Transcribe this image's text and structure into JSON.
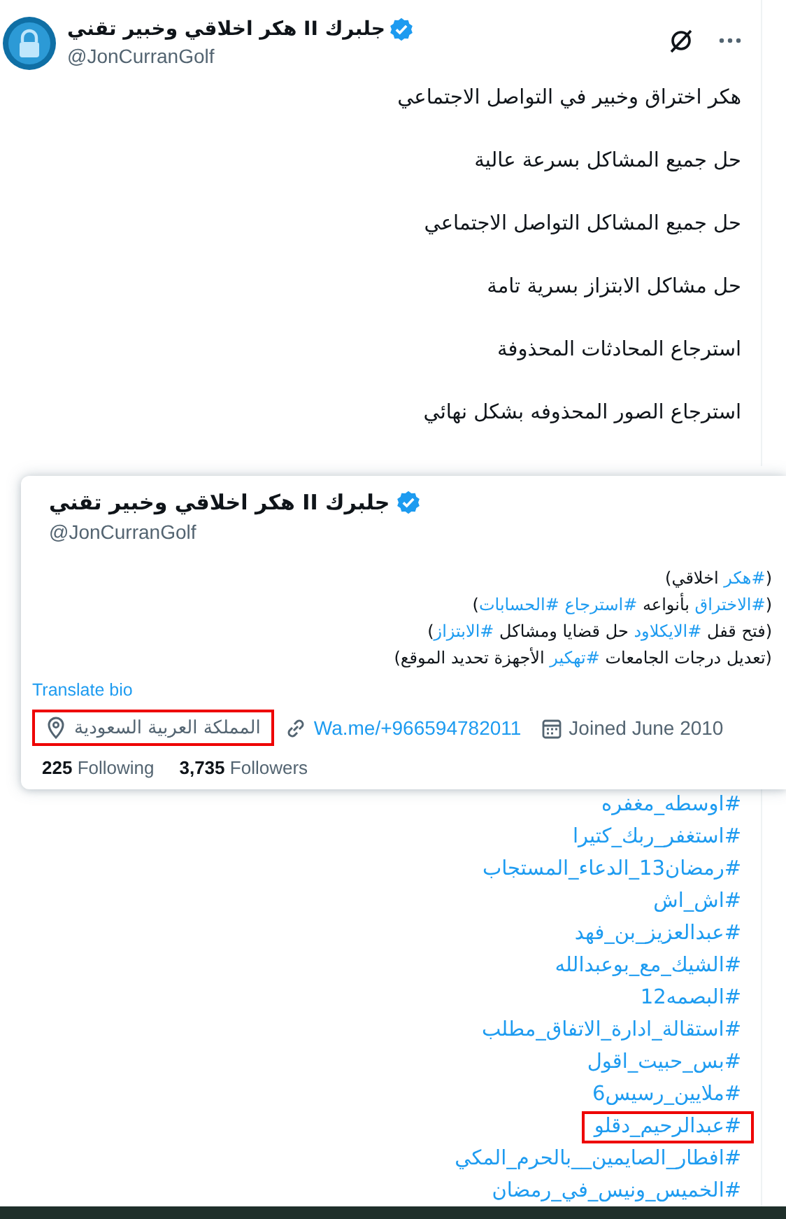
{
  "tweet": {
    "name": "جلبرك II هكر اخلاقي وخبير تقني",
    "verified": true,
    "handle": "@JonCurranGolf",
    "lines": [
      "هكر اختراق وخبير في التواصل الاجتماعي",
      "حل جميع المشاكل بسرعة عالية",
      "حل جميع المشاكل التواصل الاجتماعي",
      "حل مشاكل الابتزاز بسرية تامة",
      "استرجاع المحادثات المحذوفة",
      "استرجاع الصور المحذوفه بشكل نهائي"
    ]
  },
  "hover_card": {
    "name": "جلبرك II هكر اخلاقي وخبير تقني",
    "verified": true,
    "handle": "@JonCurranGolf",
    "bio": [
      [
        {
          "kind": "plain",
          "text": "("
        },
        {
          "kind": "hashtag",
          "text": "#هكر"
        },
        {
          "kind": "plain",
          "text": " اخلاقي)"
        }
      ],
      [
        {
          "kind": "plain",
          "text": "("
        },
        {
          "kind": "hashtag",
          "text": "#الاختراق"
        },
        {
          "kind": "plain",
          "text": " بأنواعه "
        },
        {
          "kind": "hashtag",
          "text": "#استرجاع "
        },
        {
          "kind": "hashtag",
          "text": "#الحسابات"
        },
        {
          "kind": "plain",
          "text": ")"
        }
      ],
      [
        {
          "kind": "plain",
          "text": "(فتح قفل "
        },
        {
          "kind": "hashtag",
          "text": "#الايكلاود"
        },
        {
          "kind": "plain",
          "text": " حل قضايا ومشاكل "
        },
        {
          "kind": "hashtag",
          "text": "#الابتزاز"
        },
        {
          "kind": "plain",
          "text": ")"
        }
      ],
      [
        {
          "kind": "plain",
          "text": "(تعديل درجات الجامعات "
        },
        {
          "kind": "hashtag",
          "text": "#تهكير"
        },
        {
          "kind": "plain",
          "text": " الأجهزة تحديد الموقع)"
        }
      ]
    ],
    "translate": "Translate bio",
    "location": {
      "text": "المملكة العربية السعودية",
      "highlighted": true
    },
    "link": "Wa.me/+966594782011",
    "joined": "Joined June 2010",
    "following": {
      "count": "225",
      "label": "Following"
    },
    "followers": {
      "count": "3,735",
      "label": "Followers"
    }
  },
  "hashtags": [
    {
      "text": "#اوسطه_مغفره",
      "highlighted": false
    },
    {
      "text": "#استغفر_ربك_كتيرا",
      "highlighted": false
    },
    {
      "text": "#رمضان13_الدعاء_المستجاب",
      "highlighted": false
    },
    {
      "text": "#اش_اش",
      "highlighted": false
    },
    {
      "text": "#عبدالعزيز_بن_فهد",
      "highlighted": false
    },
    {
      "text": "#الشيك_مع_بوعبدالله",
      "highlighted": false
    },
    {
      "text": "#البصمه12",
      "highlighted": false
    },
    {
      "text": "#استقالة_ادارة_الاتفاق_مطلب",
      "highlighted": false
    },
    {
      "text": "#بس_حبيت_اقول",
      "highlighted": false
    },
    {
      "text": "#ملايين_رسيس6",
      "highlighted": false
    },
    {
      "text": "#عبدالرحيم_دقلو",
      "highlighted": true
    },
    {
      "text": "#افطار_الصايمين__بالحرم_المكي",
      "highlighted": false
    },
    {
      "text": "#الخميس_ونيس_في_رمضان",
      "highlighted": false
    }
  ]
}
